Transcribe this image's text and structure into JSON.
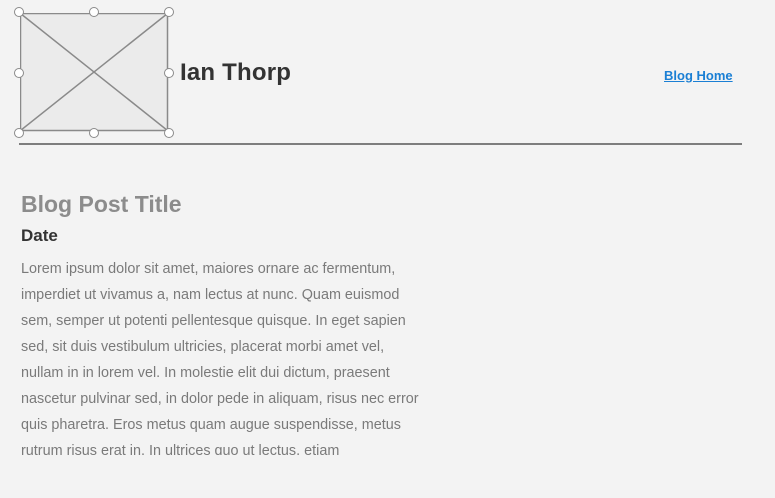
{
  "header": {
    "author_name": "Ian Thorp",
    "blog_home_label": "Blog Home",
    "image_placeholder_icon": "image-placeholder-icon"
  },
  "post": {
    "title": "Blog Post Title",
    "date": "Date",
    "body_lines": [
      "Lorem ipsum dolor sit amet, maiores ornare ac fermentum,",
      "imperdiet ut vivamus a, nam lectus at nunc. Quam euismod",
      "sem, semper ut potenti pellentesque quisque. In eget sapien",
      "sed, sit duis vestibulum ultricies, placerat morbi amet vel,",
      "nullam in in lorem vel. In molestie elit dui dictum, praesent",
      "nascetur pulvinar sed, in dolor pede in aliquam, risus nec error",
      "quis pharetra. Eros metus quam augue suspendisse, metus",
      "rutrum risus erat in.  In ultrices quo ut lectus, etiam"
    ]
  },
  "colors": {
    "background": "#f3f3f3",
    "link": "#1a7fd4",
    "title_gray": "#8c8c8c",
    "text_dark": "#333333",
    "body_gray": "#7a7a7a",
    "divider": "#7d7d7d"
  }
}
